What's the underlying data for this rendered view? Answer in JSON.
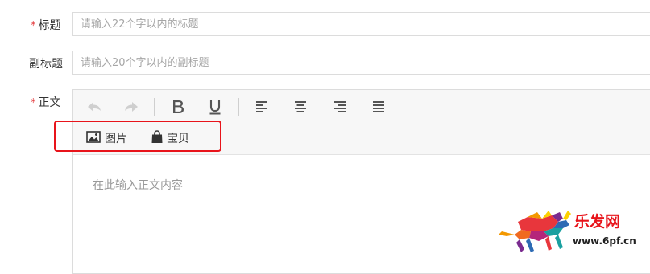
{
  "form": {
    "title": {
      "label": "标题",
      "required_mark": "*",
      "placeholder": "请输入22个字以内的标题"
    },
    "subtitle": {
      "label": "副标题",
      "placeholder": "请输入20个字以内的副标题"
    },
    "content": {
      "label": "正文",
      "required_mark": "*",
      "placeholder": "在此输入正文内容"
    }
  },
  "toolbar": {
    "buttons": [
      "undo-icon",
      "redo-icon",
      "bold-icon",
      "underline-icon",
      "align-left-icon",
      "align-center-icon",
      "align-right-icon",
      "align-justify-icon"
    ],
    "insert": {
      "image_label": "图片",
      "item_label": "宝贝"
    }
  },
  "colors": {
    "required": "#e4393c",
    "highlight_border": "#e8141b",
    "toolbar_bg": "#f7f7f7",
    "icon_active": "#555555",
    "icon_disabled": "#c8c8c8"
  },
  "watermark": {
    "brand": "乐发网",
    "url": "www.6pf.cn"
  }
}
